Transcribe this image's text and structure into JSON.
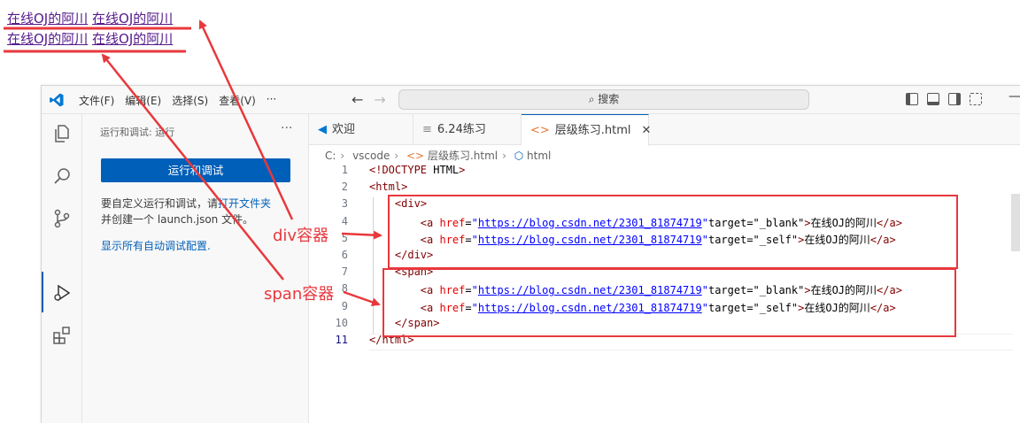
{
  "preview": {
    "line1": [
      "在线OJ的阿川",
      "在线OJ的阿川"
    ],
    "line2": [
      "在线OJ的阿川",
      "在线OJ的阿川"
    ]
  },
  "titlebar": {
    "menu": [
      "文件(F)",
      "编辑(E)",
      "选择(S)",
      "查看(V)",
      "···"
    ],
    "search_label": "搜索"
  },
  "sidebar": {
    "title": "运行和调试: 运行",
    "more": "···",
    "run_button": "运行和调试",
    "text_pre": "要自定义运行和调试，请",
    "text_link": "打开文件夹",
    "text_post": "并创建一个 launch.json 文件。",
    "show_all": "显示所有自动调试配置."
  },
  "tabs": [
    {
      "icon": "vscode-icon",
      "label": "欢迎",
      "active": false
    },
    {
      "icon": "file-lines-icon",
      "label": "6.24练习",
      "active": false
    },
    {
      "icon": "html-file-icon",
      "label": "层级练习.html",
      "active": true
    }
  ],
  "breadcrumb": [
    "C:",
    "vscode",
    "层级练习.html",
    "html"
  ],
  "code": {
    "line_numbers": [
      "1",
      "2",
      "3",
      "4",
      "5",
      "6",
      "7",
      "8",
      "9",
      "10",
      "11"
    ],
    "lines": [
      "<!DOCTYPE HTML>",
      "<html>",
      "    <div>",
      "        <a href=\"https://blog.csdn.net/2301_81874719\"target=\"_blank\">在线OJ的阿川</a>",
      "        <a href=\"https://blog.csdn.net/2301_81874719\"target=\"_self\">在线OJ的阿川</a>",
      "    </div>",
      "    <span>",
      "        <a href=\"https://blog.csdn.net/2301_81874719\"target=\"_blank\">在线OJ的阿川</a>",
      "        <a href=\"https://blog.csdn.net/2301_81874719\"target=\"_self\">在线OJ的阿川</a>",
      "    </span>",
      "</html>"
    ]
  },
  "annotations": {
    "div_label": "div容器",
    "span_label": "span容器"
  },
  "colors": {
    "annotation": "#e8383d",
    "accent": "#005fb8",
    "link_visited": "#551a8b"
  }
}
